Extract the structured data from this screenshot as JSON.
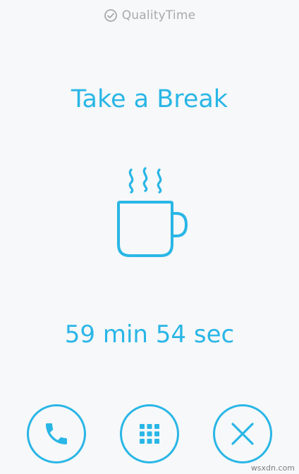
{
  "header": {
    "app_name": "QualityTime",
    "logo_icon": "clock-check-icon"
  },
  "main": {
    "title": "Take a Break",
    "illustration_icon": "coffee-mug-icon",
    "timer": "59 min 54 sec"
  },
  "actions": [
    {
      "name": "call-button",
      "icon": "phone-icon"
    },
    {
      "name": "apps-button",
      "icon": "grid-icon"
    },
    {
      "name": "close-button",
      "icon": "close-icon"
    }
  ],
  "watermark": "wsxdn.com",
  "colors": {
    "accent": "#29b6e6",
    "background": "#f7f8f9",
    "header_text": "#a9a9a9"
  }
}
